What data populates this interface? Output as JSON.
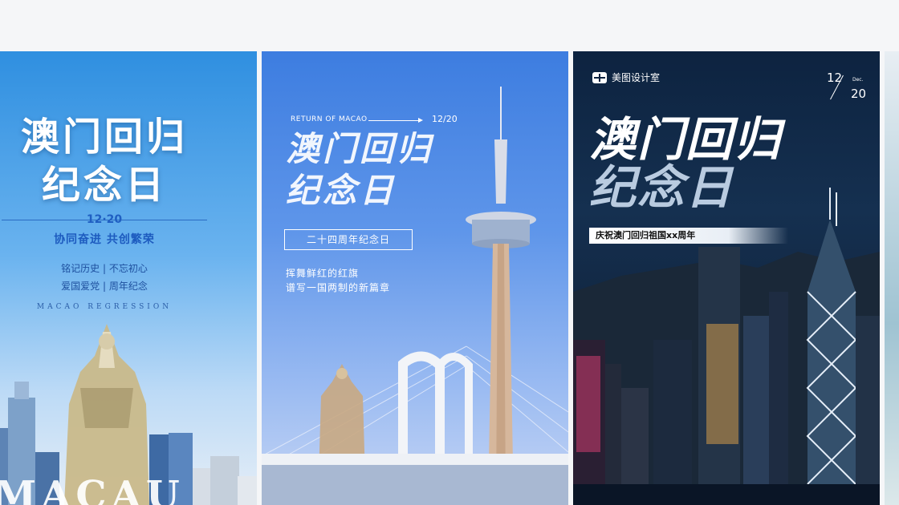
{
  "cards": [
    {
      "title_line1": "澳门回归",
      "title_line2": "纪念日",
      "date": "12·20",
      "slogan": "协同奋进  共创繁荣",
      "line1": "铭记历史  |  不忘初心",
      "line2": "爱国爱党  |  周年纪念",
      "english": "MACAO REGRESSION",
      "big_text": "MACAU"
    },
    {
      "return_text": "RETURN OF MACAO",
      "date": "12/20",
      "title_line1": "澳门回归",
      "title_line2": "纪念日",
      "box_text": "二十四周年纪念日",
      "slogan_line1": "挥舞鲜红的红旗",
      "slogan_line2": "谱写一国两制的新篇章"
    },
    {
      "brand": "美图设计室",
      "month": "12",
      "month_en": "Dec.",
      "day": "20",
      "title_line1": "澳门回归",
      "title_line2": "纪念日",
      "band_text": "庆祝澳门回归祖国xx周年"
    }
  ],
  "colors": {
    "page_bg": "#f5f6f8",
    "card1_sky": "#2f8fe0",
    "card2_sky": "#3d7de0",
    "card3_night": "#0d2340"
  }
}
